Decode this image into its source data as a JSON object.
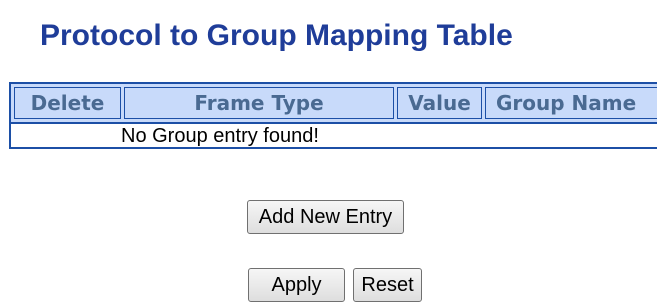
{
  "page": {
    "title": "Protocol to Group Mapping Table"
  },
  "table": {
    "columns": [
      "Delete",
      "Frame Type",
      "Value",
      "Group Name"
    ],
    "empty_message": "No Group entry found!"
  },
  "buttons": {
    "add_new_entry": "Add New Entry",
    "apply": "Apply",
    "reset": "Reset"
  },
  "colors": {
    "title": "#1f3d99",
    "table_border": "#1c4fa6",
    "header_background": "#c8dafa",
    "header_text": "#4a6a92"
  }
}
